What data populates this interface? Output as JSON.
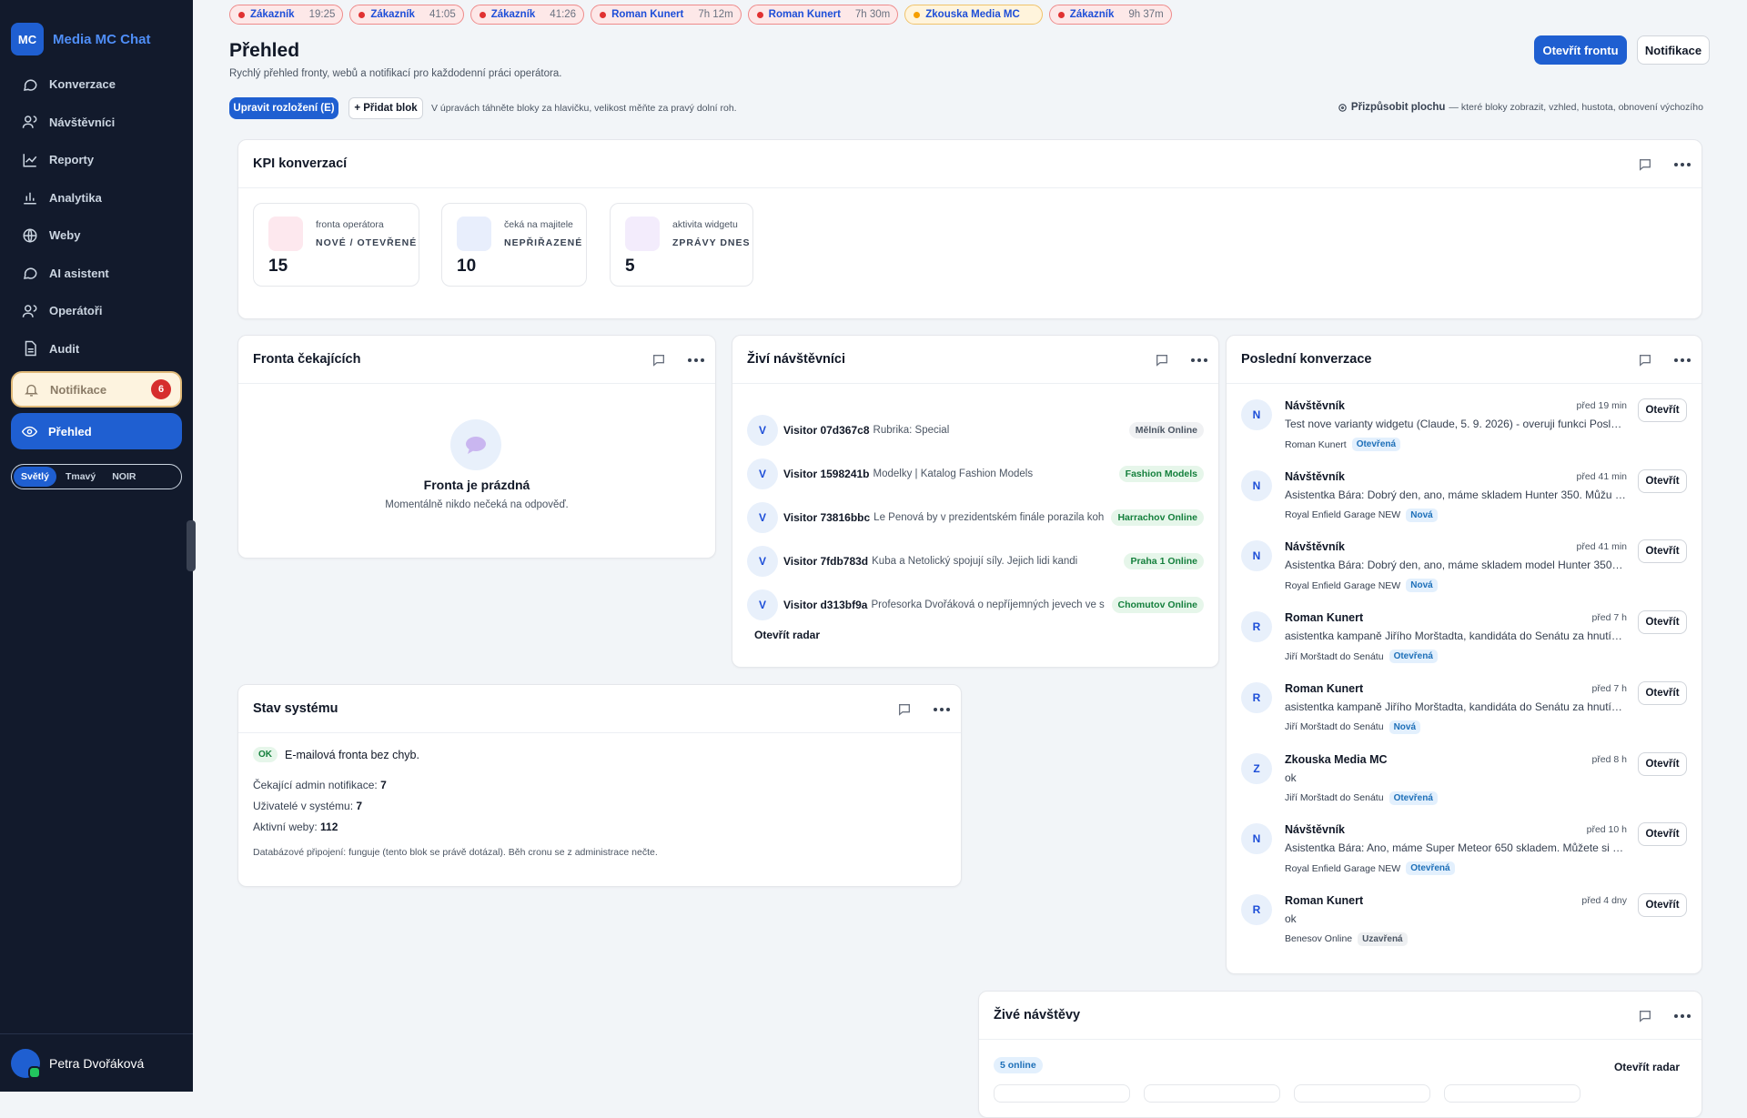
{
  "brand": {
    "logo": "MC",
    "name": "Media MC Chat"
  },
  "nav": [
    {
      "label": "Konverzace",
      "icon": "chat-icon"
    },
    {
      "label": "Návštěvníci",
      "icon": "users-icon"
    },
    {
      "label": "Reporty",
      "icon": "chart-line-icon"
    },
    {
      "label": "Analytika",
      "icon": "bar-chart-icon"
    },
    {
      "label": "Weby",
      "icon": "globe-icon"
    },
    {
      "label": "AI asistent",
      "icon": "chat-icon"
    },
    {
      "label": "Operátoři",
      "icon": "users-icon"
    },
    {
      "label": "Audit",
      "icon": "file-icon"
    }
  ],
  "nav_notif": {
    "label": "Notifikace",
    "count": "6"
  },
  "nav_active": {
    "label": "Přehled"
  },
  "theme": {
    "options": [
      "Světlý",
      "Tmavý",
      "NOIR"
    ],
    "selected": "Světlý"
  },
  "user": {
    "name": "Petra Dvořáková"
  },
  "tabs": [
    {
      "name": "Zákazník",
      "time": "19:25"
    },
    {
      "name": "Zákazník",
      "time": "41:05"
    },
    {
      "name": "Zákazník",
      "time": "41:26"
    },
    {
      "name": "Roman Kunert",
      "time": "7h 12m"
    },
    {
      "name": "Roman Kunert",
      "time": "7h 30m"
    },
    {
      "name": "Zkouska Media MC",
      "time": ""
    },
    {
      "name": "Zákazník",
      "time": "9h 37m"
    }
  ],
  "page": {
    "title": "Přehled",
    "subtitle": "Rychlý přehled fronty, webů a notifikací pro každodenní práci operátora.",
    "open_queue": "Otevřít frontu",
    "notifications": "Notifikace",
    "edit_layout": "Upravit rozložení (E)",
    "add_block": "+ Přidat blok",
    "hint": "V úpravách táhněte bloky za hlavičku, velikost měňte za pravý dolní roh.",
    "customize": "Přizpůsobit plochu",
    "customize_note": "— které bloky zobrazit, vzhled, hustota, obnovení výchozího"
  },
  "kpi": {
    "title": "KPI konverzací",
    "items": [
      {
        "label": "fronta operátora",
        "caption": "NOVÉ / OTEVŘENÉ",
        "value": "15",
        "color": "#fde8ee"
      },
      {
        "label": "čeká na majitele",
        "caption": "NEPŘIŘAZENÉ",
        "value": "10",
        "color": "#e8eefc"
      },
      {
        "label": "aktivita widgetu",
        "caption": "ZPRÁVY DNES",
        "value": "5",
        "color": "#f3ecfc"
      }
    ]
  },
  "queue": {
    "title": "Fronta čekajících",
    "empty_title": "Fronta je prázdná",
    "empty_sub": "Momentálně nikdo nečeká na odpověď."
  },
  "live": {
    "title": "Živí návštěvníci",
    "visitors": [
      {
        "avatar": "V",
        "id": "Visitor 07d367c8",
        "page": "Rubrika: Special",
        "tag": "Mělník Online",
        "tag_style": "gray"
      },
      {
        "avatar": "V",
        "id": "Visitor 1598241b",
        "page": "Modelky | Katalog Fashion Models",
        "tag": "Fashion Models",
        "tag_style": "green"
      },
      {
        "avatar": "V",
        "id": "Visitor 73816bbc",
        "page": "Le Penová by v prezidentském finále porazila koh",
        "tag": "Harrachov Online",
        "tag_style": "green"
      },
      {
        "avatar": "V",
        "id": "Visitor 7fdb783d",
        "page": "Kuba a Netolický spojují síly. Jejich lidi kandi",
        "tag": "Praha 1 Online",
        "tag_style": "green"
      },
      {
        "avatar": "V",
        "id": "Visitor d313bf9a",
        "page": "Profesorka Dvořáková o nepříjemných jevech ve sp",
        "tag": "Chomutov Online",
        "tag_style": "green"
      }
    ],
    "open_radar": "Otevřít radar"
  },
  "recent": {
    "title": "Poslední konverzace",
    "open_label": "Otevřít",
    "items": [
      {
        "avatar": "N",
        "name": "Návštěvník",
        "time": "před 19 min",
        "msg": "Test nove varianty widgetu (Claude, 5. 9. 2026) - overuji funkci Posla…",
        "site": "Roman Kunert",
        "status": "Otevřená",
        "status_style": "blue"
      },
      {
        "avatar": "N",
        "name": "Návštěvník",
        "time": "před 41 min",
        "msg": "Asistentka Bára: Dobrý den, ano, máme skladem Hunter 350. Můžu …",
        "site": "Royal Enfield Garage NEW",
        "status": "Nová",
        "status_style": "blue"
      },
      {
        "avatar": "N",
        "name": "Návštěvník",
        "time": "před 41 min",
        "msg": "Asistentka Bára: Dobrý den, ano, máme skladem model Hunter 350…",
        "site": "Royal Enfield Garage NEW",
        "status": "Nová",
        "status_style": "blue"
      },
      {
        "avatar": "R",
        "name": "Roman Kunert",
        "time": "před 7 h",
        "msg": "asistentka kampaně Jiřího Morštadta, kandidáta do Senátu za hnutí…",
        "site": "Jiří Morštadt do Senátu",
        "status": "Otevřená",
        "status_style": "blue"
      },
      {
        "avatar": "R",
        "name": "Roman Kunert",
        "time": "před 7 h",
        "msg": "asistentka kampaně Jiřího Morštadta, kandidáta do Senátu za hnutí…",
        "site": "Jiří Morštadt do Senátu",
        "status": "Nová",
        "status_style": "blue"
      },
      {
        "avatar": "Z",
        "name": "Zkouska Media MC",
        "time": "před 8 h",
        "msg": "ok",
        "site": "Jiří Morštadt do Senátu",
        "status": "Otevřená",
        "status_style": "blue"
      },
      {
        "avatar": "N",
        "name": "Návštěvník",
        "time": "před 10 h",
        "msg": "Asistentka Bára: Ano, máme Super Meteor 650 skladem. Můžete si h…",
        "site": "Royal Enfield Garage NEW",
        "status": "Otevřená",
        "status_style": "blue"
      },
      {
        "avatar": "R",
        "name": "Roman Kunert",
        "time": "před 4 dny",
        "msg": "ok",
        "site": "Benesov Online",
        "status": "Uzavřená",
        "status_style": "gray"
      }
    ]
  },
  "system": {
    "title": "Stav systému",
    "ok_badge": "OK",
    "ok_text": "E-mailová fronta bez chyb.",
    "lines": [
      {
        "label": "Čekající admin notifikace:",
        "value": "7"
      },
      {
        "label": "Uživatelé v systému:",
        "value": "7"
      },
      {
        "label": "Aktivní weby:",
        "value": "112"
      }
    ],
    "note": "Databázové připojení: funguje (tento blok se právě dotázal). Běh cronu se z administrace nečte."
  },
  "live_visits": {
    "title": "Živé návštěvy",
    "online": "5 online",
    "open_radar": "Otevřít radar"
  },
  "colors": {
    "accent": "#1f5fd1",
    "sidebar": "#121a2c",
    "danger": "#e03131",
    "success": "#15803d"
  }
}
